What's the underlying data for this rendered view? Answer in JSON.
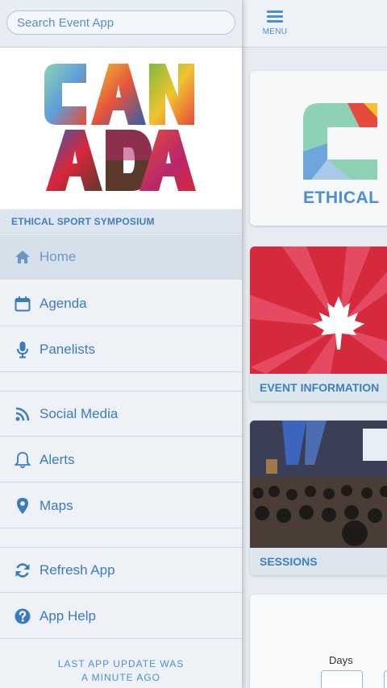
{
  "search": {
    "placeholder": "Search Event App"
  },
  "brand": {
    "logo_line1": "CAN",
    "logo_line2": "ADA",
    "event_title": "ETHICAL SPORT SYMPOSIUM"
  },
  "nav": {
    "items": [
      {
        "label": "Home",
        "icon": "home-icon",
        "active": true
      },
      {
        "label": "Agenda",
        "icon": "calendar-icon"
      },
      {
        "label": "Panelists",
        "icon": "microphone-icon"
      },
      {
        "label": "Social Media",
        "icon": "rss-icon"
      },
      {
        "label": "Alerts",
        "icon": "bell-icon"
      },
      {
        "label": "Maps",
        "icon": "map-marker-icon"
      },
      {
        "label": "Refresh App",
        "icon": "refresh-icon"
      },
      {
        "label": "App Help",
        "icon": "question-circle-icon"
      }
    ]
  },
  "update": {
    "line1": "LAST APP UPDATE WAS",
    "line2": "A MINUTE AGO"
  },
  "header": {
    "menu_label": "MENU"
  },
  "cards": {
    "logo_text": "ETHICAL",
    "event_info": "EVENT INFORMATION",
    "sessions": "SESSIONS",
    "countdown_days_label": "Days"
  },
  "colors": {
    "accent": "#3c7bbf",
    "canada_red": "#d9263a"
  }
}
